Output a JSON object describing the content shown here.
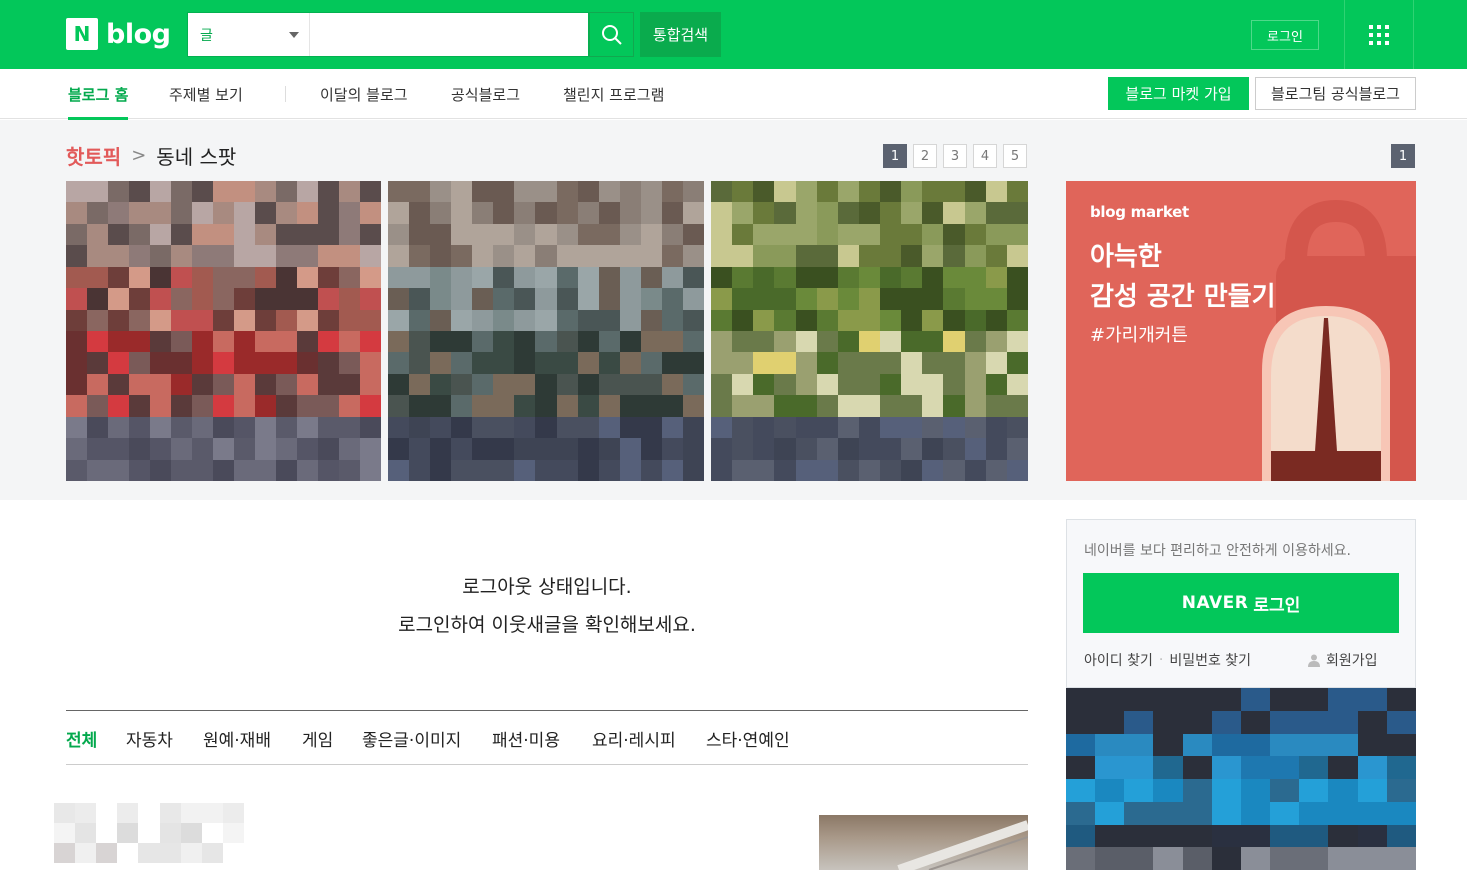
{
  "header": {
    "logo_n": "N",
    "logo_text": "blog",
    "search_category": "글",
    "search_placeholder": "",
    "integrated_search": "통합검색",
    "login": "로그인"
  },
  "nav": {
    "items": [
      "블로그 홈",
      "주제별 보기",
      "이달의 블로그",
      "공식블로그",
      "챌린지 프로그램"
    ],
    "market_join": "블로그 마켓 가입",
    "team_blog": "블로그팀 공식블로그"
  },
  "hot_topic": {
    "label": "핫토픽",
    "subtitle": "동네 스팟",
    "pages": [
      "1",
      "2",
      "3",
      "4",
      "5"
    ],
    "current_page": "1",
    "side_page": "1"
  },
  "ad": {
    "brand": "blog market",
    "headline_1": "아늑한",
    "headline_2": "감성 공간 만들기",
    "tag": "#가리개커튼"
  },
  "main": {
    "logout_line1": "로그아웃 상태입니다.",
    "logout_line2": "로그인하여 이웃새글을 확인해보세요.",
    "categories": [
      "전체",
      "자동차",
      "원예·재배",
      "게임",
      "좋은글·이미지",
      "패션·미용",
      "요리·레시피",
      "스타·연예인"
    ]
  },
  "login_box": {
    "message": "네이버를 보다 편리하고 안전하게 이용하세요.",
    "naver_label": "NAVER",
    "login_label": "로그인",
    "find_id": "아이디 찾기",
    "find_pw": "비밀번호 찾기",
    "signup": "회원가입"
  },
  "colors": {
    "brand_green": "#03c75a",
    "hot_red": "#e25a5a",
    "ad_coral": "#e0655a"
  }
}
